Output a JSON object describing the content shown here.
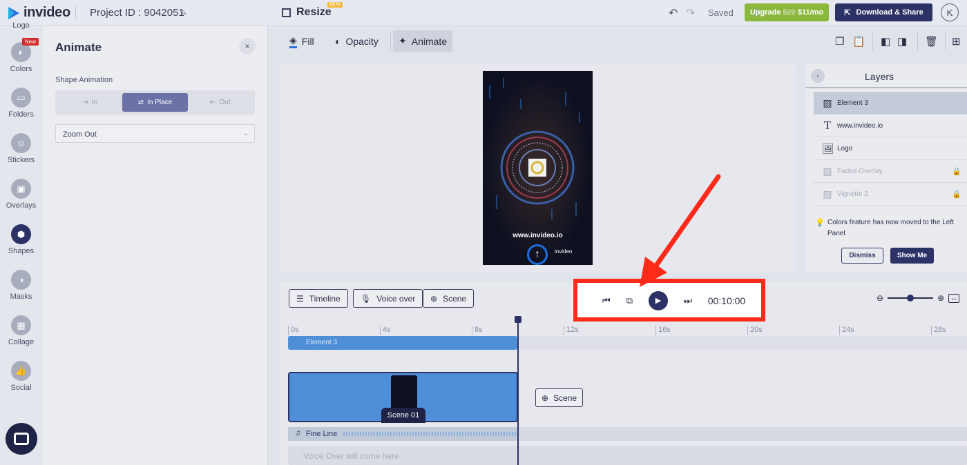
{
  "topbar": {
    "logo_text": "invideo",
    "project_id": "Project ID : 9042051",
    "resize_label": "Resize",
    "beta_badge": "BETA",
    "saved": "Saved",
    "upgrade_old_price": "$22",
    "upgrade_label": "Upgrade",
    "upgrade_new_price": "$11/mo",
    "download_label": "Download & Share",
    "avatar_letter": "K"
  },
  "rail": {
    "partial_top": "Logo",
    "new_badge": "New",
    "items": [
      {
        "label": "Colors"
      },
      {
        "label": "Folders"
      },
      {
        "label": "Stickers"
      },
      {
        "label": "Overlays"
      },
      {
        "label": "Shapes"
      },
      {
        "label": "Masks"
      },
      {
        "label": "Collage"
      },
      {
        "label": "Social"
      }
    ]
  },
  "panel": {
    "title": "Animate",
    "close": "×",
    "subtitle": "Shape Animation",
    "segments": [
      {
        "label": "In"
      },
      {
        "label": "In Place"
      },
      {
        "label": "Out"
      }
    ],
    "select_value": "Zoom Out"
  },
  "toolbar": {
    "fill": "Fill",
    "opacity": "Opacity",
    "animate": "Animate"
  },
  "video": {
    "url_text": "www.invideo.io",
    "brand_text": "invideo"
  },
  "layers": {
    "title": "Layers",
    "items": [
      {
        "label": "Element 3"
      },
      {
        "label": "www.invideo.io"
      },
      {
        "label": "Logo"
      },
      {
        "label": "Faded Overlay"
      },
      {
        "label": "Vignette 2"
      }
    ],
    "tip": "Colors feature has now moved to the Left Panel",
    "dismiss": "Dismiss",
    "show_me": "Show Me"
  },
  "timeline": {
    "timeline_btn": "Timeline",
    "voiceover_btn": "Voice over",
    "scene_btn": "Scene",
    "time": "00:10:00",
    "ticks": [
      "0s",
      "4s",
      "8s",
      "12s",
      "16s",
      "20s",
      "24s",
      "28s"
    ],
    "element_track": "Element 3",
    "scene_label": "Scene 01",
    "add_scene": "Scene",
    "audio_track": "Fine Line",
    "voiceover_placeholder": "Voice Over will come here"
  },
  "colors": {
    "accent": "#2c3166",
    "upgrade": "#8ab73c",
    "track": "#4f8fd8",
    "highlight": "#ff2a1a"
  }
}
